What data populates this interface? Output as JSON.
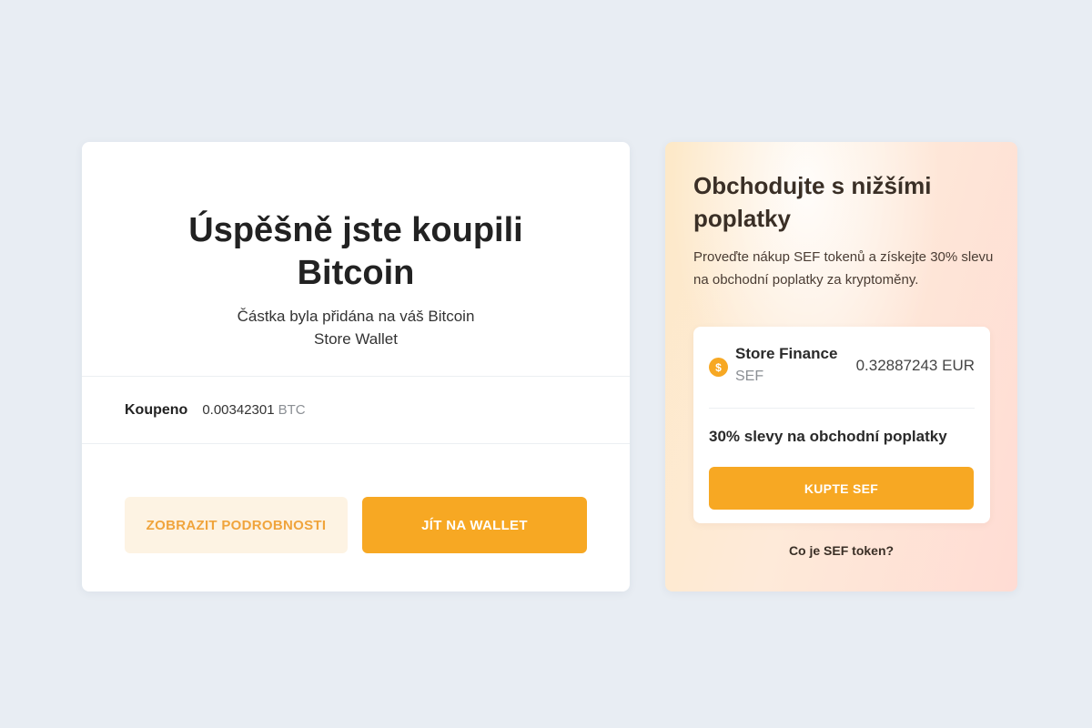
{
  "success": {
    "title": "Úspěšně jste koupili Bitcoin",
    "subtitle": "Částka byla přidána na váš Bitcoin Store Wallet",
    "bought_label": "Koupeno",
    "bought_amount": "0.00342301",
    "bought_unit": "BTC",
    "details_button": "ZOBRAZIT PODROBNOSTI",
    "wallet_button": "JÍT NA WALLET"
  },
  "promo": {
    "title": "Obchodujte s nižšími poplatky",
    "text": "Proveďte nákup SEF tokenů a získejte 30% slevu na obchodní poplatky za kryptoměny.",
    "token_icon": "$",
    "token_name": "Store Finance",
    "token_symbol": "SEF",
    "token_price": "0.32887243 EUR",
    "discount_text": "30% slevy na obchodní poplatky",
    "buy_button": "KUPTE SEF",
    "info_link": "Co je SEF token?"
  },
  "colors": {
    "accent": "#f7a823",
    "accent_light": "#fdf3e3",
    "background": "#e8edf3"
  }
}
